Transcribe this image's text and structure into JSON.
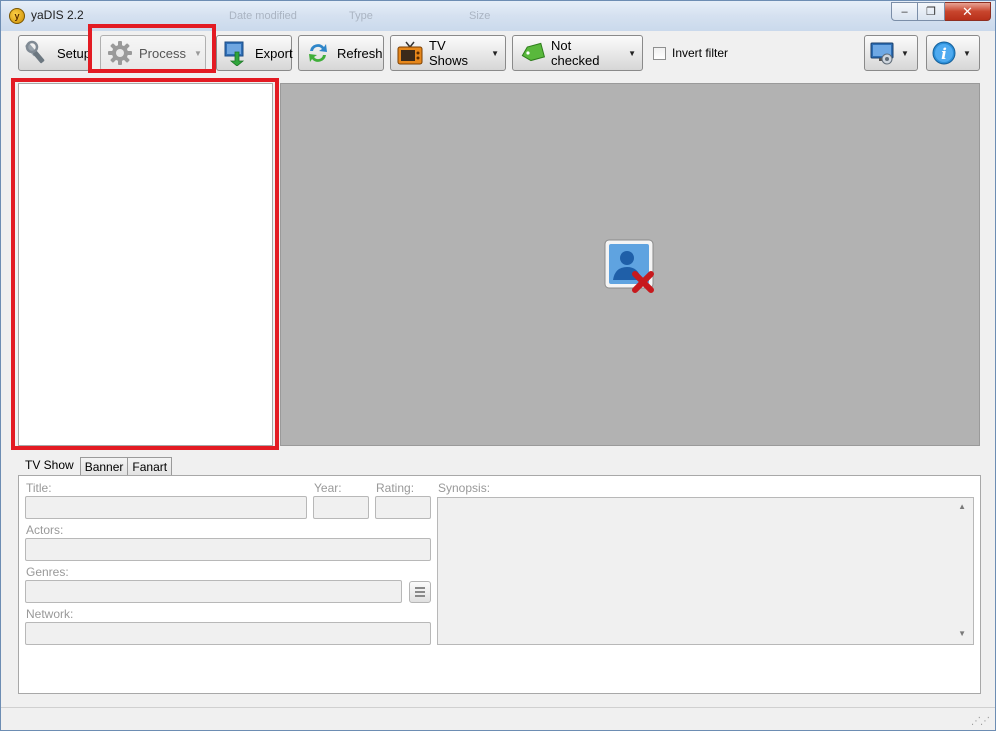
{
  "window": {
    "title": "yaDIS 2.2",
    "ghost_columns": [
      "Date modified",
      "Type",
      "Size"
    ],
    "minimize_label": "‒",
    "restore_label": "❐",
    "close_label": "✕"
  },
  "toolbar": {
    "setup_label": "Setup",
    "process_label": "Process",
    "export_label": "Export",
    "refresh_label": "Refresh",
    "tvshows_label": "TV Shows",
    "filter_label": "Not checked",
    "invert_filter_label": "Invert filter",
    "invert_filter_checked": false
  },
  "tabs": [
    "TV Show",
    "Banner",
    "Fanart"
  ],
  "form": {
    "title_label": "Title:",
    "year_label": "Year:",
    "rating_label": "Rating:",
    "synopsis_label": "Synopsis:",
    "actors_label": "Actors:",
    "genres_label": "Genres:",
    "network_label": "Network:",
    "title_value": "",
    "year_value": "",
    "rating_value": "",
    "actors_value": "",
    "genres_value": "",
    "network_value": "",
    "synopsis_value": ""
  },
  "icons": {
    "app": "yadis-app-icon",
    "setup": "wrench-screwdriver-icon",
    "process": "gear-icon",
    "export": "export-arrow-icon",
    "refresh": "refresh-icon",
    "tvshows": "tv-icon",
    "filter": "tag-icon",
    "display": "monitor-settings-icon",
    "info": "info-icon",
    "preview": "no-image-person-icon"
  },
  "colors": {
    "highlight": "#e31b23",
    "preview_bg": "#b2b2b2"
  }
}
